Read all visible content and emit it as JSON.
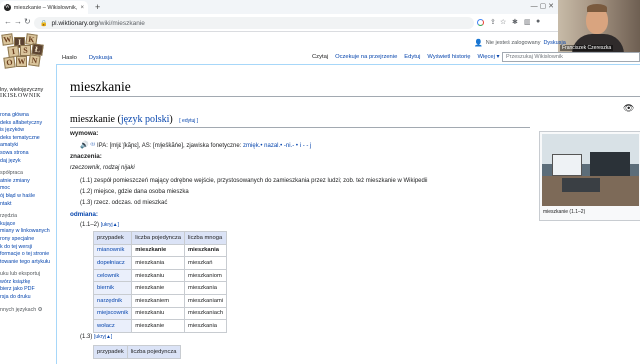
{
  "browser": {
    "tab_title": "mieszkanie – Wikisłownik, wolny",
    "tab_close": "×",
    "new_tab": "+",
    "window_controls": "—   ▢   ✕",
    "url_host": "pl.wiktionary.org",
    "url_path": "/wiki/mieszkanie"
  },
  "webcam": {
    "name": "Franciszek Czereszka"
  },
  "site": {
    "logo_letters": [
      "W",
      "I",
      "K",
      "I",
      "S",
      "Ł",
      "O",
      "W",
      "N"
    ],
    "tagline1": "lny, wielojęzyczny",
    "tagline2": "IKISŁOWNIK"
  },
  "personal": {
    "status": "Nie jesteś zalogowany",
    "link": "Dyskusja"
  },
  "leftnav": [
    {
      "type": "item",
      "text": "rona główna"
    },
    {
      "type": "item",
      "text": "deks alfabetyczny"
    },
    {
      "type": "item",
      "text": "is języków"
    },
    {
      "type": "item",
      "text": "deks tematyczne"
    },
    {
      "type": "item",
      "text": "amatyki"
    },
    {
      "type": "item",
      "text": "sowa strona"
    },
    {
      "type": "item",
      "text": "daj język"
    },
    {
      "type": "grp",
      "text": "spółpraca"
    },
    {
      "type": "item",
      "text": "atnie zmiany"
    },
    {
      "type": "item",
      "text": "moc"
    },
    {
      "type": "item",
      "text": "ój błąd w haśle"
    },
    {
      "type": "item",
      "text": "ntakt"
    },
    {
      "type": "grp",
      "text": "rzędzia"
    },
    {
      "type": "item",
      "text": "kujące"
    },
    {
      "type": "item",
      "text": "miany w linkowanych"
    },
    {
      "type": "item",
      "text": "rony specjalne"
    },
    {
      "type": "item",
      "text": "k do tej wersji"
    },
    {
      "type": "item",
      "text": "formacje o tej stronie"
    },
    {
      "type": "item",
      "text": "towanie tego artykułu"
    },
    {
      "type": "grp",
      "text": "uku lub eksportuj"
    },
    {
      "type": "item",
      "text": "wórz książkę"
    },
    {
      "type": "item",
      "text": "bierz jako PDF"
    },
    {
      "type": "item",
      "text": "rsja do druku"
    },
    {
      "type": "grp",
      "text": "nnych językach ⚙"
    }
  ],
  "tabs_left": [
    "Hasło",
    "Dyskusja"
  ],
  "tabs_right": [
    "Czytaj",
    "Oczekuje na przejrzenie",
    "Edytuj",
    "Wyświetl historię",
    "Więcej ▾"
  ],
  "search_placeholder": "Przeszukaj Wikisłownik",
  "page_title": "mieszkanie",
  "section": {
    "word": "mieszkanie (",
    "lang_link": "język polski",
    "close": ")",
    "edit": "[ edytuj ]"
  },
  "labels": {
    "wymowa": "wymowa:",
    "znaczenia": "znaczenia:",
    "odmiana": "odmiana:"
  },
  "pronunciation": {
    "speaker": "🔊",
    "sup": "⁽¹⁾",
    "ipa": "IPA: [mʲjɛ̇ˈʃkãɲɛ], AS: [mʲi̯ešk̇ãńe], zjawiska fonetyczne: ",
    "phen": "zmięk.• nazal.• -ni.- • i - - j"
  },
  "pos": "rzeczownik, rodzaj nijaki",
  "definitions": [
    {
      "num": "(1.1)",
      "text": "zespół pomieszczeń mający odrębne wejście, przystosowanych do zamieszkania przez ludzi; zob. też mieszkanie w Wikipedii"
    },
    {
      "num": "(1.2)",
      "text": "miejsce, gdzie dana osoba mieszka"
    },
    {
      "num": "(1.3)",
      "text": "rzecz. odczas. od mieszkać"
    }
  ],
  "odmiana_ref1": "(1.1–2)",
  "odmiana_ref2": "(1.3)",
  "toggle": "[ukryj▲]",
  "table1": {
    "headers": [
      "przypadek",
      "liczba pojedyncza",
      "liczba mnoga"
    ],
    "rows": [
      [
        "mianownik",
        "mieszkanie",
        "mieszkania"
      ],
      [
        "dopełniacz",
        "mieszkania",
        "mieszkań"
      ],
      [
        "celownik",
        "mieszkaniu",
        "mieszkaniom"
      ],
      [
        "biernik",
        "mieszkanie",
        "mieszkania"
      ],
      [
        "narzędnik",
        "mieszkaniem",
        "mieszkaniami"
      ],
      [
        "miejscownik",
        "mieszkaniu",
        "mieszkaniach"
      ],
      [
        "wołacz",
        "mieszkanie",
        "mieszkania"
      ]
    ]
  },
  "table2": {
    "headers": [
      "przypadek",
      "liczba pojedyncza"
    ]
  },
  "thumb_caption": "mieszkanie (1.1–2)"
}
